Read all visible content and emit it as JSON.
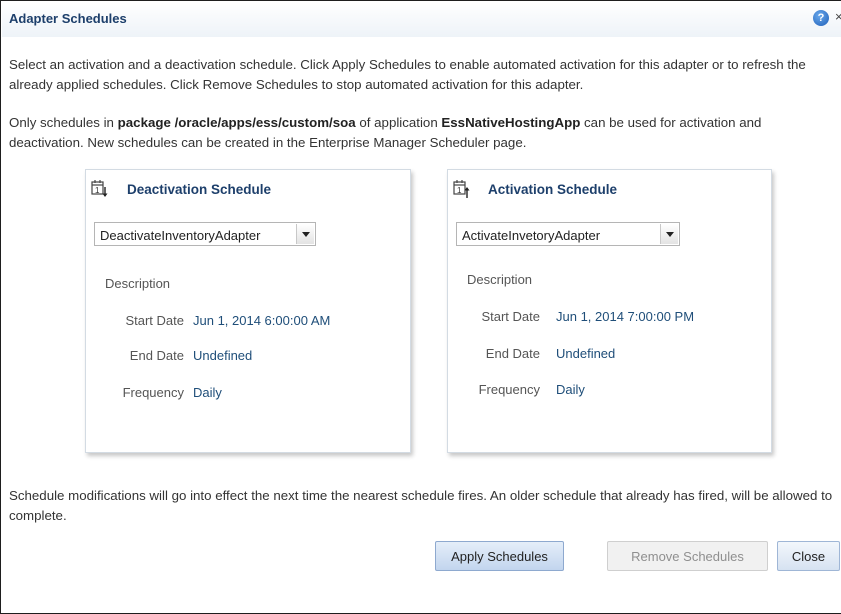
{
  "dialog": {
    "title": "Adapter Schedules",
    "help_icon": "?",
    "close_icon": "×",
    "intro_1": "Select an activation and a deactivation schedule. Click Apply Schedules to enable automated activation for this adapter or to refresh the already applied schedules. Click Remove Schedules to stop automated activation for this adapter.",
    "intro_2": {
      "prefix": "Only schedules in ",
      "package_word": "package",
      "package_path": "/oracle/apps/ess/custom/soa",
      "middle": " of application ",
      "app_name": "EssNativeHostingApp",
      "suffix": " can be used for activation and deactivation. New schedules can be created in the Enterprise Manager Scheduler page."
    },
    "footer_note": "Schedule modifications will go into effect the next time the nearest schedule fires. An older schedule that already has fired, will be allowed to complete."
  },
  "deactivation": {
    "title": "Deactivation Schedule",
    "selected": "DeactivateInventoryAdapter",
    "description_label": "Description",
    "start_label": "Start Date",
    "start_value": "Jun 1, 2014 6:00:00 AM",
    "end_label": "End Date",
    "end_value": "Undefined",
    "frequency_label": "Frequency",
    "frequency_value": "Daily"
  },
  "activation": {
    "title": "Activation Schedule",
    "selected": "ActivateInvetoryAdapter",
    "description_label": "Description",
    "start_label": "Start Date",
    "start_value": "Jun 1, 2014 7:00:00 PM",
    "end_label": "End Date",
    "end_value": "Undefined",
    "frequency_label": "Frequency",
    "frequency_value": "Daily"
  },
  "buttons": {
    "apply": "Apply Schedules",
    "remove": "Remove Schedules",
    "close": "Close"
  },
  "icons": {
    "deactivation": "calendar-down-arrow-icon",
    "activation": "calendar-up-arrow-icon"
  },
  "colors": {
    "title": "#1d3f6b",
    "link": "#1f4e79",
    "primary_button": "#c2d5ee"
  }
}
